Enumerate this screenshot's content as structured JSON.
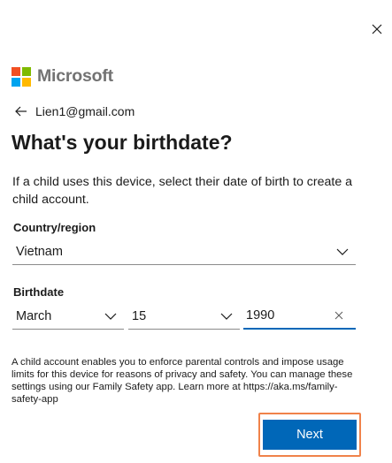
{
  "brand": {
    "name": "Microsoft",
    "logo_colors": [
      "#f25022",
      "#7fba00",
      "#00a4ef",
      "#ffb900"
    ]
  },
  "account": {
    "email": "Lien1@gmail.com"
  },
  "page": {
    "title": "What's your birthdate?",
    "description": "If a child uses this device, select their date of birth to create a child account."
  },
  "country": {
    "label": "Country/region",
    "value": "Vietnam"
  },
  "birthdate": {
    "label": "Birthdate",
    "month": "March",
    "day": "15",
    "year": "1990"
  },
  "note": "A child account enables you to enforce parental controls and impose usage limits for this device for reasons of privacy and safety. You can manage these settings using our Family Safety app. Learn more at https://aka.ms/family-safety-app",
  "actions": {
    "next_label": "Next"
  },
  "colors": {
    "accent": "#0067b8",
    "focus_outline": "#f0824a"
  }
}
